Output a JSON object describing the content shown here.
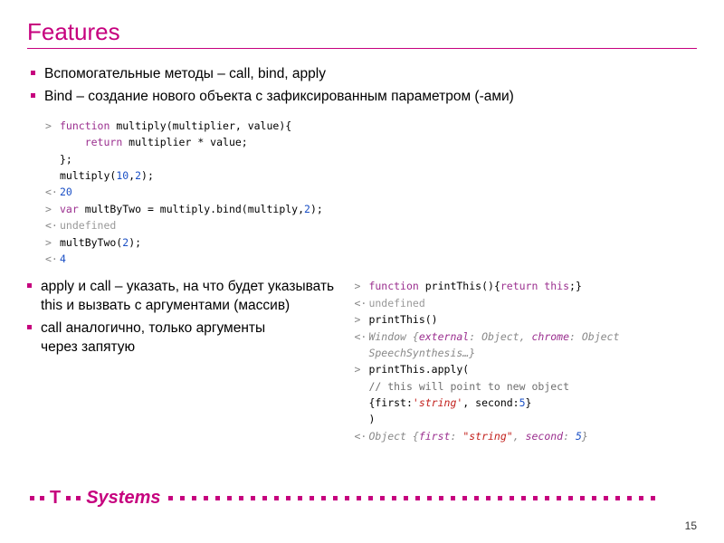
{
  "title": "Features",
  "bullets": {
    "b1": "Вспомогательные методы – call, bind, apply",
    "b2": "Bind – создание нового объекта с зафиксированным параметром (-ами)",
    "b3a": "apply и call – указать, на что будет указывать",
    "b3b": "this и вызвать с аргументами (массив)",
    "b4a": "call аналогично, только аргументы",
    "b4b": "через запятую"
  },
  "code1": {
    "l1_kw": "function",
    "l1_rest": " multiply(multiplier, value){",
    "l2_kw": "return",
    "l2_rest": " multiplier * value;",
    "l3": "};",
    "l4_a": "multiply(",
    "l4_n1": "10",
    "l4_c": ",",
    "l4_n2": "2",
    "l4_b": ");",
    "r1": "20",
    "l5_kw": "var",
    "l5_rest": " multByTwo = multiply.bind(multiply,",
    "l5_n": "2",
    "l5_end": ");",
    "r2": "undefined",
    "l6_a": "multByTwo(",
    "l6_n": "2",
    "l6_b": ");",
    "r3": "4"
  },
  "code2": {
    "l1_kw": "function",
    "l1_mid": " printThis(){",
    "l1_kw2": "return this",
    "l1_end": ";}",
    "r1": "undefined",
    "l2": "printThis()",
    "r2_a": "Window {",
    "r2_k1": "external",
    "r2_m": ": Object, ",
    "r2_k2": "chrome",
    "r2_e": ": Object",
    "r2_line2": "SpeechSynthesis…}",
    "l3": "printThis.apply(",
    "l3c": "// this will point to new object",
    "l3b_a": "{first:",
    "l3b_str": "'string'",
    "l3b_m": ", second:",
    "l3b_n": "5",
    "l3b_e": "}",
    "l3end": ")",
    "r3_a": "Object {",
    "r3_k1": "first",
    "r3_m1": ": ",
    "r3_str": "\"string\"",
    "r3_m2": ", ",
    "r3_k2": "second",
    "r3_m3": ": ",
    "r3_n": "5",
    "r3_e": "}"
  },
  "logo": {
    "brand": "T",
    "name": "Systems"
  },
  "pageNumber": "15"
}
